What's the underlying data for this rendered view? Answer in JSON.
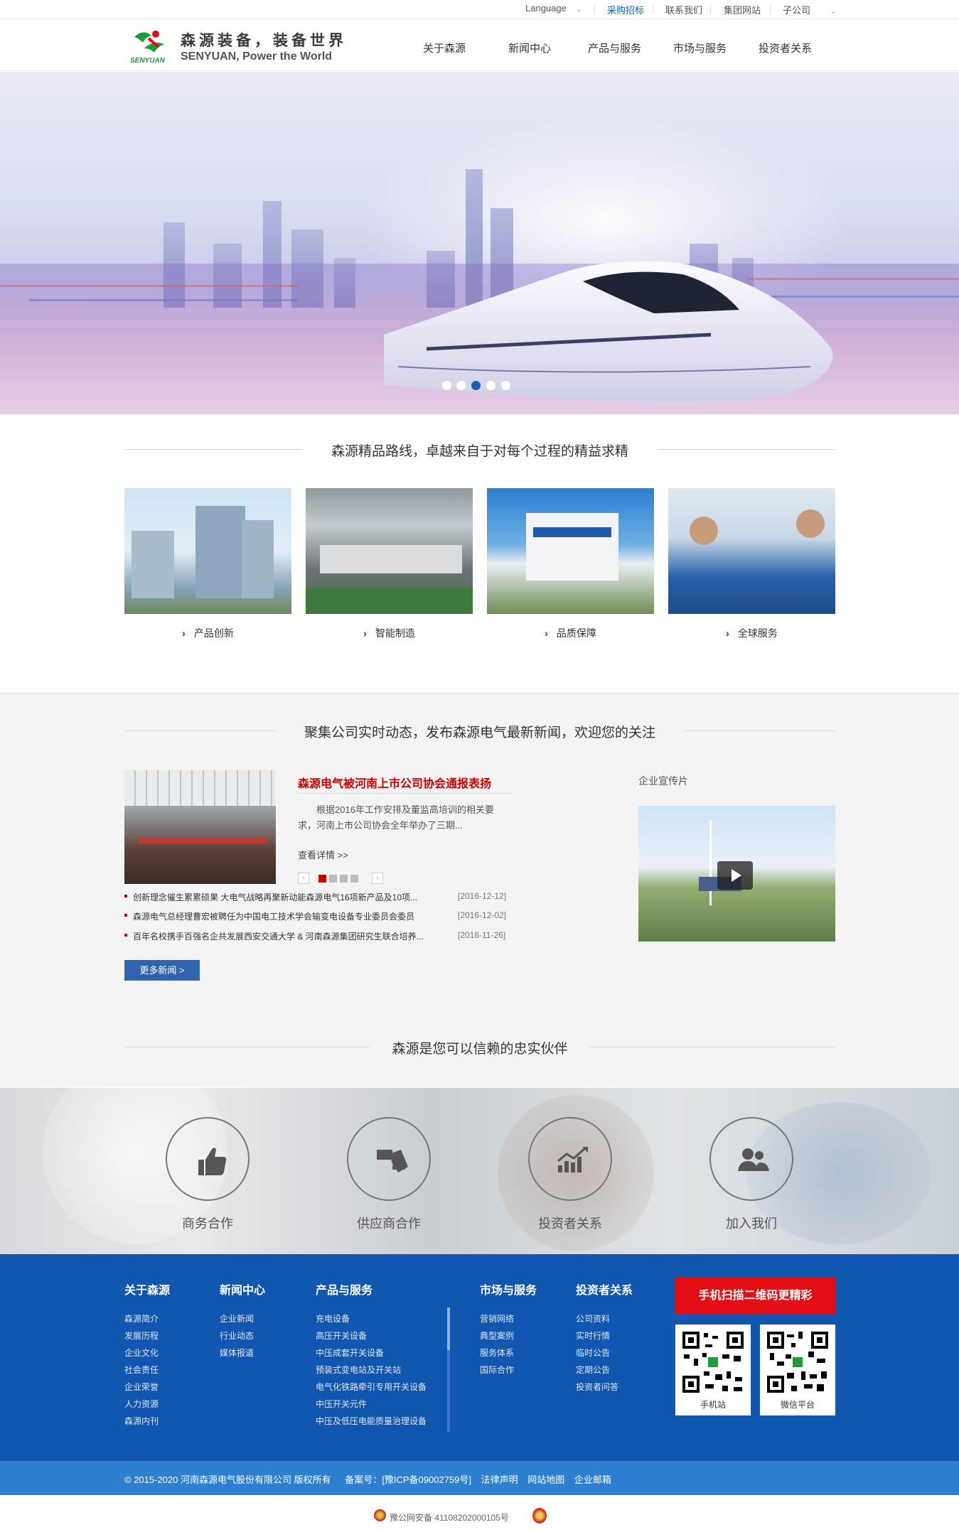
{
  "topbar": {
    "language": "Language",
    "language_arrow": "⌄",
    "procurement": "采购招标",
    "contact": "联系我们",
    "group_site": "集团网站",
    "subsidiary": "子公司",
    "subsidiary_arrow": "⌄"
  },
  "header": {
    "logo_brand": "SENYUAN",
    "slogan_cn": "森源装备，装备世界",
    "slogan_en": "SENYUAN, Power the World",
    "nav": [
      "关于森源",
      "新闻中心",
      "产品与服务",
      "市场与服务",
      "投资者关系"
    ]
  },
  "banner": {
    "dots": 5,
    "active_dot": 3
  },
  "lean": {
    "title": "森源精品路线，卓越来自于对每个过程的精益求精",
    "cards": [
      {
        "label": "产品创新",
        "chevron": "›"
      },
      {
        "label": "智能制造",
        "chevron": "›"
      },
      {
        "label": "品质保障",
        "chevron": "›"
      },
      {
        "label": "全球服务",
        "chevron": "›"
      }
    ]
  },
  "news": {
    "title": "聚集公司实时动态，发布森源电气最新新闻，欢迎您的关注",
    "headline": "森源电气被河南上市公司协会通报表扬",
    "summary": "根据2016年工作安排及董监高培训的相关要求，河南上市公司协会全年举办了三期...",
    "read_more": "查看详情 >>",
    "pager_prev": "‹",
    "pager_next": "›",
    "items": [
      {
        "title": "创新理念催生累累硕果 大电气战略再聚新动能森源电气16项新产品及10项...",
        "date": "[2016-12-12]"
      },
      {
        "title": "森源电气总经理曹宏被聘任为中国电工技术学会输变电设备专业委员会委员",
        "date": "[2016-12-02]"
      },
      {
        "title": "百年名校携手百强名企共发展西安交通大学 & 河南森源集团研究生联合培养...",
        "date": "[2016-11-26]"
      }
    ],
    "more_button": "更多新闻 >",
    "video_label": "企业宣传片"
  },
  "partners": {
    "title": "森源是您可以信赖的忠实伙伴",
    "items": [
      {
        "label": "商务合作",
        "icon": "thumbs-up-icon"
      },
      {
        "label": "供应商合作",
        "icon": "handshake-icon"
      },
      {
        "label": "投资者关系",
        "icon": "chart-growth-icon"
      },
      {
        "label": "加入我们",
        "icon": "people-icon"
      }
    ]
  },
  "footer": {
    "columns": [
      {
        "title": "关于森源",
        "links": [
          "森源简介",
          "发展历程",
          "企业文化",
          "社会责任",
          "企业荣誉",
          "人力资源",
          "森源内刊"
        ]
      },
      {
        "title": "新闻中心",
        "links": [
          "企业新闻",
          "行业动态",
          "媒体报道"
        ]
      },
      {
        "title": "产品与服务",
        "links": [
          "充电设备",
          "高压开关设备",
          "中压成套开关设备",
          "预装式变电站及开关站",
          "电气化铁路牵引专用开关设备",
          "中压开关元件",
          "中压及低压电能质量治理设备"
        ]
      },
      {
        "title": "市场与服务",
        "links": [
          "营销网络",
          "典型案例",
          "服务体系",
          "国际合作"
        ]
      },
      {
        "title": "投资者关系",
        "links": [
          "公司资料",
          "实时行情",
          "临时公告",
          "定期公告",
          "投资者问答"
        ]
      }
    ],
    "qr_title": "手机扫描二维码更精彩",
    "qr_mobile": "手机站",
    "qr_wechat": "微信平台",
    "copyright": "© 2015-2020 河南森源电气股份有限公司 版权所有",
    "icp": "备案号：[豫ICP备09002759号]",
    "legal": "法律声明",
    "sitemap": "网站地图",
    "mail": "企业邮箱",
    "police": "豫公网安备 41108202000105号"
  },
  "colors": {
    "brand_blue": "#1156b0",
    "accent_red": "#e30d14",
    "logo_green": "#1e9b3a"
  }
}
